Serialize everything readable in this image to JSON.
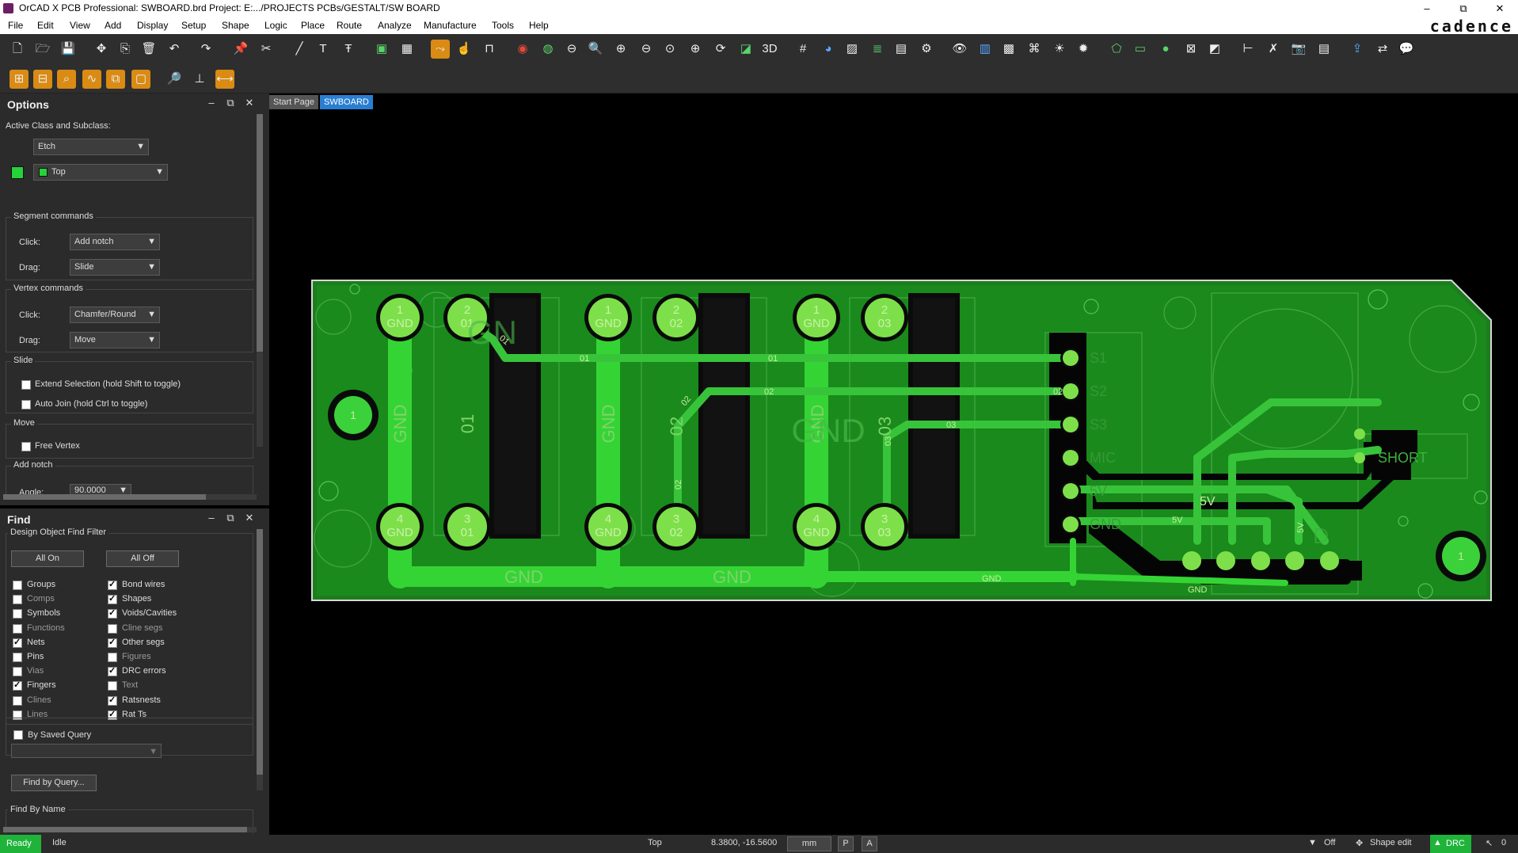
{
  "window": {
    "title": "OrCAD X PCB Professional: SWBOARD.brd  Project: E:.../PROJECTS PCBs/GESTALT/SW BOARD",
    "min": "–",
    "max": "⧉",
    "close": "✕"
  },
  "menu": [
    "File",
    "Edit",
    "View",
    "Add",
    "Display",
    "Setup",
    "Shape",
    "Logic",
    "Place",
    "Route",
    "Analyze",
    "Manufacture",
    "Tools",
    "Help"
  ],
  "brand": "cadence",
  "options": {
    "title": "Options",
    "active_class_label": "Active Class and Subclass:",
    "class_value": "Etch",
    "subclass_value": "Top",
    "subclass_color": "#27d13a",
    "segment": {
      "title": "Segment commands",
      "click_label": "Click:",
      "click_value": "Add notch",
      "drag_label": "Drag:",
      "drag_value": "Slide"
    },
    "vertex": {
      "title": "Vertex commands",
      "click_label": "Click:",
      "click_value": "Chamfer/Round",
      "drag_label": "Drag:",
      "drag_value": "Move"
    },
    "slide": {
      "title": "Slide",
      "extend": "Extend Selection (hold Shift to toggle)",
      "autojoin": "Auto Join (hold Ctrl to toggle)"
    },
    "move": {
      "title": "Move",
      "free_vertex": "Free Vertex"
    },
    "add_notch": {
      "title": "Add notch",
      "angle_label": "Angle:",
      "angle_value": "90.0000"
    }
  },
  "find": {
    "title": "Find",
    "filter_title": "Design Object Find Filter",
    "all_on": "All On",
    "all_off": "All Off",
    "left_items": [
      {
        "label": "Groups",
        "checked": false,
        "enabled": true
      },
      {
        "label": "Comps",
        "checked": false,
        "enabled": false
      },
      {
        "label": "Symbols",
        "checked": false,
        "enabled": true
      },
      {
        "label": "Functions",
        "checked": false,
        "enabled": false
      },
      {
        "label": "Nets",
        "checked": true,
        "enabled": true
      },
      {
        "label": "Pins",
        "checked": false,
        "enabled": true
      },
      {
        "label": "Vias",
        "checked": false,
        "enabled": false
      },
      {
        "label": "Fingers",
        "checked": true,
        "enabled": true
      },
      {
        "label": "Clines",
        "checked": false,
        "enabled": false
      },
      {
        "label": "Lines",
        "checked": false,
        "enabled": false
      }
    ],
    "right_items": [
      {
        "label": "Bond wires",
        "checked": true,
        "enabled": true
      },
      {
        "label": "Shapes",
        "checked": true,
        "enabled": true
      },
      {
        "label": "Voids/Cavities",
        "checked": true,
        "enabled": true
      },
      {
        "label": "Cline segs",
        "checked": false,
        "enabled": false
      },
      {
        "label": "Other segs",
        "checked": true,
        "enabled": true
      },
      {
        "label": "Figures",
        "checked": false,
        "enabled": false
      },
      {
        "label": "DRC errors",
        "checked": true,
        "enabled": true
      },
      {
        "label": "Text",
        "checked": false,
        "enabled": false
      },
      {
        "label": "Ratsnests",
        "checked": true,
        "enabled": true
      },
      {
        "label": "Rat Ts",
        "checked": true,
        "enabled": true
      }
    ],
    "by_saved_query": "By Saved Query",
    "find_by_query": "Find by Query...",
    "find_by_name": "Find By Name"
  },
  "tabs": [
    "Start Page",
    "SWBOARD"
  ],
  "board": {
    "pads_top": [
      {
        "n": "1",
        "net": "GND"
      },
      {
        "n": "2",
        "net": "01"
      },
      {
        "n": "1",
        "net": "GND"
      },
      {
        "n": "2",
        "net": "02"
      },
      {
        "n": "1",
        "net": "GND"
      },
      {
        "n": "2",
        "net": "03"
      }
    ],
    "pads_bottom": [
      {
        "n": "4",
        "net": "GND"
      },
      {
        "n": "3",
        "net": "01"
      },
      {
        "n": "4",
        "net": "GND"
      },
      {
        "n": "3",
        "net": "02"
      },
      {
        "n": "4",
        "net": "GND"
      },
      {
        "n": "3",
        "net": "03"
      }
    ],
    "silk_vertical": [
      "GND",
      "01",
      "GND",
      "02",
      "GND",
      "03"
    ],
    "big_gnd": "GND",
    "header_labels": [
      "S1",
      "S2",
      "S3",
      "MIC",
      "5V",
      "GND"
    ],
    "bottom_gnd_labels": [
      "GND",
      "GND"
    ],
    "trace_labels": [
      "01",
      "01",
      "01",
      "02",
      "02",
      "02",
      "03",
      "03",
      "02",
      "GND",
      "5V",
      "5V",
      "5V",
      "GND"
    ],
    "short_label": "SHORT",
    "mount_hole": "1",
    "partial_gnd": "GN",
    "d_label": "D"
  },
  "status": {
    "ready": "Ready",
    "idle": "Idle",
    "layer": "Top",
    "coords": "8.3800, -16.5600",
    "units": "mm",
    "p": "P",
    "a": "A",
    "filter": "Off",
    "mode": "Shape edit",
    "drc": "DRC",
    "count": "0"
  }
}
